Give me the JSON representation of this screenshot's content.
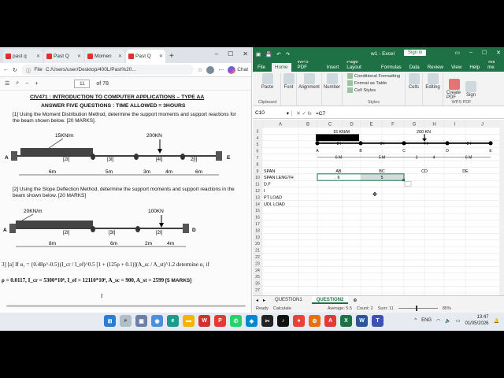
{
  "browser": {
    "tabs": [
      {
        "label": "past q"
      },
      {
        "label": "Past Q"
      },
      {
        "label": "Momen"
      },
      {
        "label": "Past Q"
      }
    ],
    "url": "C:/Users/user/Desktop/400L/Past%20...",
    "file_label": "File",
    "copilot_label": "Chat",
    "page_current": "11",
    "page_total": "of 78"
  },
  "document": {
    "title": "CIV471 : INTRODUCTION TO COMPUTER APPLICATIONS – TYPE AA",
    "subtitle": "ANSWER FIVE QUESTIONS :    TIME ALLOWED = 3HOURS",
    "q1": "[1] Using the Moment Distribution Method, determine the support moments and support reactions for the beam shown below. [20 MARKS].",
    "q2": "[2] Using the Slope Deflection Method, determine the support moments and support reactions in the beam shown below. [20 MARKS]",
    "beam1": {
      "udl_label": "15KN/m",
      "point_label": "200KN",
      "support_a": "A",
      "support_e": "E",
      "support_b": "B",
      "support_c": "C",
      "support_d": "D",
      "stiffness": [
        "[2I]",
        "[3I]",
        "[4I]",
        "2[I]"
      ],
      "spans": [
        "6m",
        "5m",
        "3m",
        "4m",
        "6m"
      ]
    },
    "beam2": {
      "udl_label": "20KN/m",
      "point_label": "100KN",
      "support_a": "A",
      "support_d": "D",
      "stiffness": [
        "[2I]",
        "[3I]",
        "[2I]"
      ],
      "spans": [
        "8m",
        "6m",
        "2m",
        "4m"
      ]
    },
    "q3_line1": "3] [a] If α₁ = {0.48ρ^-0.5}(I_cr / I_ef)^0.5 [1 + (125ρ + 0.1)](A_sc / A_st)^1.2     determine α₁ if",
    "q3_line2": "ρ = 0.0117, I_cr = 5300*10⁶, I_ef = 12110*10⁶, A_sc = 900, A_st = 2599",
    "q3_marks": "[5 MARKS]",
    "q3_trail": "I"
  },
  "excel": {
    "title": "w1 - Excel",
    "signin": "Sign in",
    "menu": [
      "File",
      "Home",
      "WPS PDF",
      "Insert",
      "Page Layout",
      "Formulas",
      "Data",
      "Review",
      "View",
      "Help",
      "Tell me"
    ],
    "ribbon": {
      "paste": "Paste",
      "clipboard": "Clipboard",
      "font": "Font",
      "alignment": "Alignment",
      "number": "Number",
      "conditional": "Conditional Formatting",
      "format_table": "Format as Table",
      "cell_styles": "Cell Styles",
      "styles": "Styles",
      "cells": "Cells",
      "editing": "Editing",
      "create_pdf": "Create PDF",
      "sign": "Sign",
      "wps_pdf": "WPS PDF"
    },
    "name_box": "C10",
    "formula": "=C7",
    "columns": [
      "A",
      "B",
      "C",
      "D",
      "E",
      "F",
      "G",
      "H",
      "I",
      "J"
    ],
    "rows": [
      "3",
      "4",
      "5",
      "6",
      "7",
      "8",
      "9",
      "10",
      "11",
      "12",
      "13",
      "14",
      "15",
      "16",
      "17",
      "18",
      "19",
      "20",
      "21",
      "22",
      "23",
      "24",
      "25",
      "26",
      "27"
    ],
    "drawing": {
      "udl": "15 KN/M",
      "point": "200 KN",
      "node_letters": [
        "A",
        "B",
        "C",
        "D",
        "E"
      ],
      "stiffness": [
        "2 I",
        "3 I",
        "4 I",
        "2 I"
      ],
      "spans": [
        "6 M",
        "5 M",
        "3",
        "4",
        "6 M"
      ]
    },
    "labels": {
      "span": "SPAN",
      "span_length": "SPAN LENGTH",
      "df": "D.F",
      "i": "I",
      "pt_load": "PT LOAD",
      "udl_load": "UDL LOAD"
    },
    "span_names": [
      "AB",
      "BC",
      "CD",
      "DE"
    ],
    "span_lengths": [
      "6",
      "5"
    ],
    "sheets": [
      "QUESTION1",
      "QUESTION2"
    ],
    "status": {
      "ready": "Ready",
      "calc": "Calculate",
      "average": "Average: 5.5",
      "count": "Count: 2",
      "sum": "Sum: 11",
      "zoom": "85%"
    }
  },
  "taskbar": {
    "time": "13:47",
    "date": "01/05/2026",
    "lang": "ENG"
  }
}
